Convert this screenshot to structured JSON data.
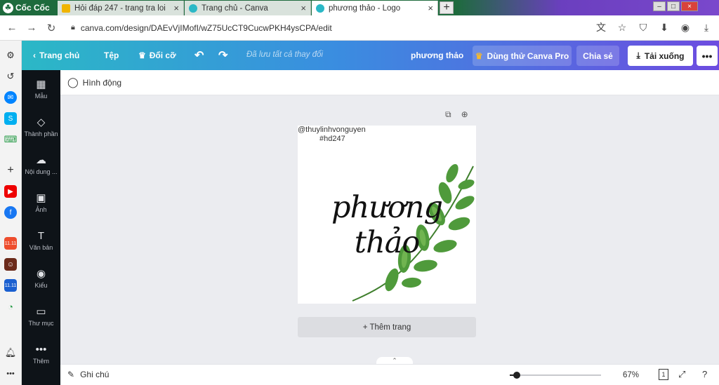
{
  "browser": {
    "brand": "Cốc Cốc",
    "tabs": [
      {
        "title": "Hỏi đáp 247 - trang tra loi",
        "favicon_color": "#f0b400"
      },
      {
        "title": "Trang chủ - Canva",
        "favicon_color": "#2bb8c6"
      },
      {
        "title": "phương thảo - Logo",
        "favicon_color": "#2bb8c6"
      }
    ],
    "new_tab_label": "+",
    "tab_close": "×",
    "url": "canva.com/design/DAEvVjIMofI/wZ75UcCT9CucwPKH4ysCPA/edit"
  },
  "canva": {
    "topbar": {
      "home_label": "Trang chủ",
      "file_label": "Tệp",
      "resize_label": "Đổi cỡ",
      "saved_text": "Đã lưu tất cả thay đổi",
      "design_title": "phương thảo",
      "pro_label": "Dùng thử Canva Pro",
      "share_label": "Chia sẻ",
      "download_label": "Tải xuống",
      "more_label": "•••"
    },
    "side_tools": [
      {
        "label": "Mẫu",
        "icon": "▦"
      },
      {
        "label": "Thành phần",
        "icon": "◇"
      },
      {
        "label": "Nội dung ...",
        "icon": "☁"
      },
      {
        "label": "Ảnh",
        "icon": "▣"
      },
      {
        "label": "Văn bản",
        "icon": "T"
      },
      {
        "label": "Kiểu",
        "icon": "◉"
      },
      {
        "label": "Thư mục",
        "icon": "▭"
      },
      {
        "label": "Thêm",
        "icon": "•••"
      }
    ],
    "subbar": {
      "animate_label": "Hình động"
    },
    "page": {
      "handle_text": "@thuylinhvonguyen",
      "hashtag_text": "#hd247",
      "script_text": "phương thảo"
    },
    "add_page_label": "+ Thêm trang",
    "bottombar": {
      "notes_label": "Ghi chú",
      "zoom_value": "67%",
      "zoom_fraction": 0.08,
      "page_count": "1"
    }
  },
  "colors": {
    "canva_gradient_start": "#2bb8c6",
    "canva_gradient_end": "#6d4ce0",
    "side_panel": "#0e1318",
    "leaf_green": "#4f9a3b"
  }
}
